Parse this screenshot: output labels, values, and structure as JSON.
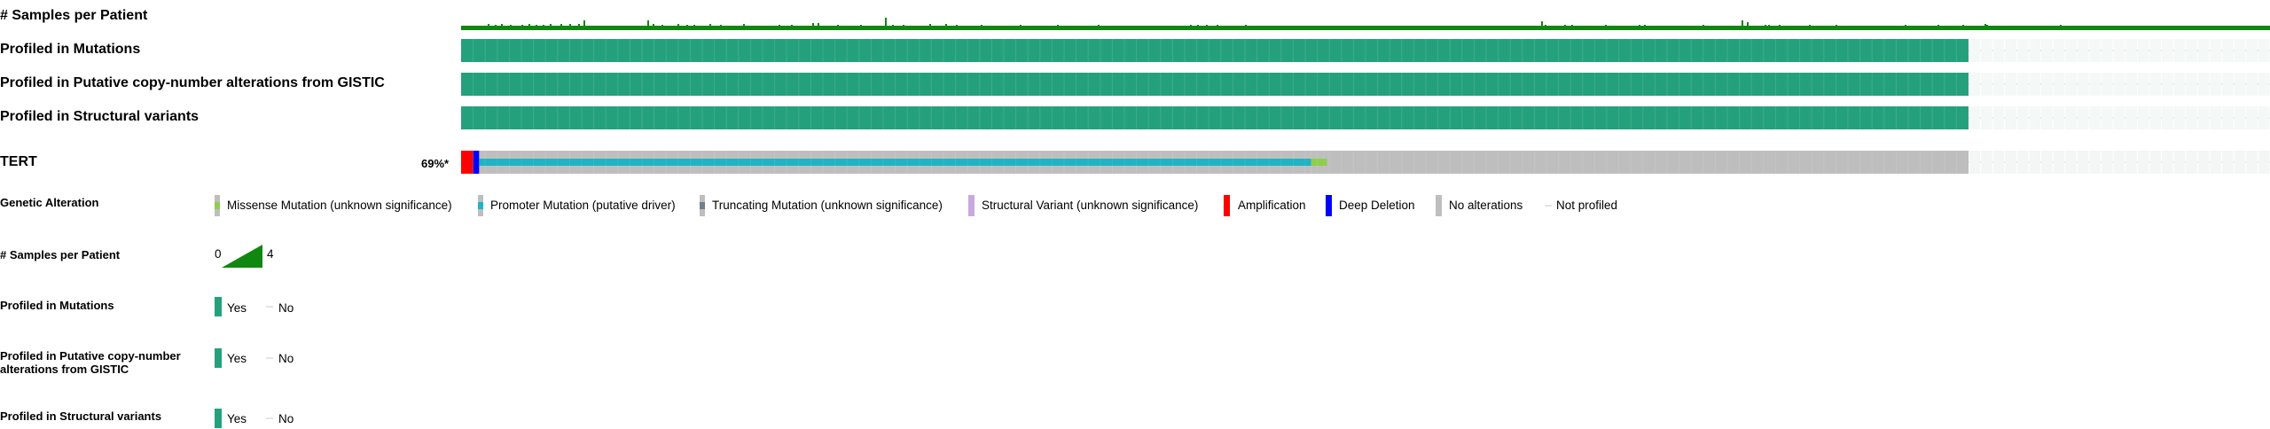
{
  "tracks": {
    "samples_per_patient": "# Samples per Patient",
    "profiled_mutations": "Profiled in Mutations",
    "profiled_cna": "Profiled in Putative copy-number alterations from GISTIC",
    "profiled_sv": "Profiled in Structural variants"
  },
  "gene": {
    "name": "TERT",
    "altered_percent": "69%*",
    "total_cases": 150,
    "profiled_cases": 125,
    "segments": [
      {
        "type": "amplification",
        "count": 1
      },
      {
        "type": "deep_deletion",
        "count": 0.5
      },
      {
        "type": "promoter_mutation",
        "count": 69
      },
      {
        "type": "missense_mutation_promoter",
        "count": 1
      },
      {
        "type": "missense_mutation",
        "count": 0.3
      },
      {
        "type": "no_alterations",
        "count": 53.2
      },
      {
        "type": "not_profiled",
        "count": 25
      }
    ]
  },
  "legend": {
    "genetic_alteration": {
      "title": "Genetic Alteration",
      "items": [
        {
          "label": "Missense Mutation (unknown significance)",
          "color": "#8fce4a"
        },
        {
          "label": "Promoter Mutation (putative driver)",
          "color": "#1fb3c4"
        },
        {
          "label": "Truncating Mutation (unknown significance)",
          "color": "#708090"
        },
        {
          "label": "Structural Variant (unknown significance)",
          "color": "#c9a8e0"
        },
        {
          "label": "Amplification",
          "color": "#ff0000"
        },
        {
          "label": "Deep Deletion",
          "color": "#0000ff"
        },
        {
          "label": "No alterations",
          "color": "#bebebe"
        },
        {
          "label": "Not profiled",
          "color": "#d0d0d0"
        }
      ]
    },
    "samples_per_patient": {
      "title": "# Samples per Patient",
      "min": "0",
      "max": "4"
    },
    "profiled_mutations": {
      "title": "Profiled in Mutations",
      "yes": "Yes",
      "no": "No"
    },
    "profiled_cna": {
      "title": "Profiled in Putative copy-number alterations from GISTIC",
      "yes": "Yes",
      "no": "No"
    },
    "profiled_sv": {
      "title": "Profiled in Structural variants",
      "yes": "Yes",
      "no": "No"
    }
  },
  "colors": {
    "profiled": "#24a17c",
    "samples": "#108710",
    "not_profiled_line": "#c8c8c8"
  }
}
